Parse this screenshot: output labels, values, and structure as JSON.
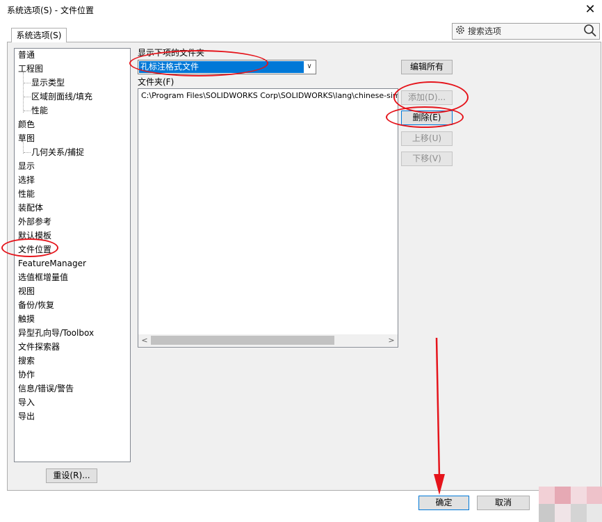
{
  "window": {
    "title": "系统选项(S) - 文件位置",
    "close_glyph": "✕"
  },
  "tabs": [
    {
      "label": "系统选项(S)"
    }
  ],
  "search": {
    "placeholder": "搜索选项"
  },
  "tree": {
    "items": [
      {
        "label": "普通",
        "level": 0
      },
      {
        "label": "工程图",
        "level": 0
      },
      {
        "label": "显示类型",
        "level": 1
      },
      {
        "label": "区域剖面线/填充",
        "level": 1
      },
      {
        "label": "性能",
        "level": 1
      },
      {
        "label": "颜色",
        "level": 0
      },
      {
        "label": "草图",
        "level": 0
      },
      {
        "label": "几何关系/捕捉",
        "level": 1
      },
      {
        "label": "显示",
        "level": 0
      },
      {
        "label": "选择",
        "level": 0
      },
      {
        "label": "性能",
        "level": 0
      },
      {
        "label": "装配体",
        "level": 0
      },
      {
        "label": "外部参考",
        "level": 0
      },
      {
        "label": "默认模板",
        "level": 0
      },
      {
        "label": "文件位置",
        "level": 0,
        "selected": true
      },
      {
        "label": "FeatureManager",
        "level": 0
      },
      {
        "label": "选值框增量值",
        "level": 0
      },
      {
        "label": "视图",
        "level": 0
      },
      {
        "label": "备份/恢复",
        "level": 0
      },
      {
        "label": "触摸",
        "level": 0
      },
      {
        "label": "异型孔向导/Toolbox",
        "level": 0
      },
      {
        "label": "文件探索器",
        "level": 0
      },
      {
        "label": "搜索",
        "level": 0
      },
      {
        "label": "协作",
        "level": 0
      },
      {
        "label": "信息/错误/警告",
        "level": 0
      },
      {
        "label": "导入",
        "level": 0
      },
      {
        "label": "导出",
        "level": 0
      }
    ]
  },
  "reset_button": {
    "label": "重设(R)..."
  },
  "main": {
    "show_folders_label": "显示下项的文件夹",
    "show_folders_value": "孔标注格式文件",
    "folders_label": "文件夹(F)",
    "folders": [
      "C:\\Program Files\\SOLIDWORKS Corp\\SOLIDWORKS\\lang\\chinese-simplified"
    ],
    "scroll_left_glyph": "<",
    "scroll_right_glyph": ">",
    "combo_arrow_glyph": "∨"
  },
  "buttons": {
    "edit_all": "编辑所有",
    "add": "添加(D)...",
    "delete": "删除(E)",
    "move_up": "上移(U)",
    "move_down": "下移(V)",
    "ok": "确定",
    "cancel": "取消"
  },
  "icons": {
    "settings": "gear-icon",
    "search": "magnifier-icon",
    "dropdown": "chevron-down-icon"
  },
  "colors": {
    "selection": "#0078d7",
    "annotation": "#e5141b",
    "window_bg": "#f0f0f0"
  }
}
